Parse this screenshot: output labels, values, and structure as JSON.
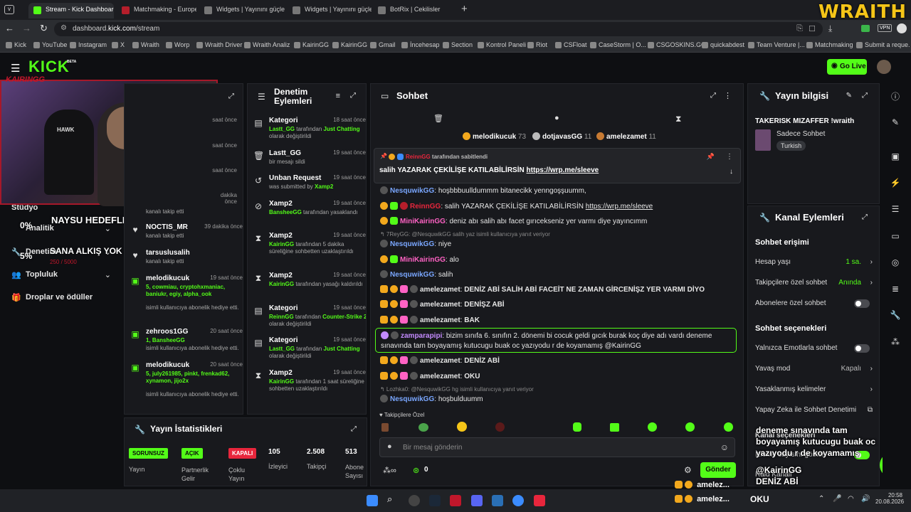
{
  "browser": {
    "tabs": [
      {
        "title": "Stream - Kick Dashboard",
        "active": true
      },
      {
        "title": "Matchmaking - Europe 5v5",
        "active": false
      },
      {
        "title": "Widgets | Yayınını güçlendi",
        "active": false
      },
      {
        "title": "Widgets | Yayınını güçlendi",
        "active": false
      },
      {
        "title": "BotRix | Cekilisler",
        "active": false
      }
    ],
    "new_tab": "+",
    "url_host": "dashboard.",
    "url_domain": "kick.com",
    "url_path": "/stream",
    "bookmarks": [
      "Kick",
      "YouTube",
      "Instagram",
      "X",
      "Wraith",
      "Worp",
      "Wraith Driver",
      "Wraith Analiz",
      "KairinGG",
      "KairinGG",
      "Gmail",
      "İncehesap",
      "Section",
      "Kontrol Paneli",
      "Riot",
      "CSFloat",
      "CaseStorm | O...",
      "CSGOSKINS.GG",
      "quickabdest",
      "Team Venture |...",
      "Matchmaking",
      "Submit a reque..."
    ],
    "vpn": "VPN"
  },
  "overlay": {
    "wraith_logo": "WRAITH",
    "streamer_tag": "KAIRINGG",
    "webcam_brand": "HAWK",
    "goal_1_text": "NAYSU HEDEFLER",
    "goal_1_pct": "0%",
    "goal_2_text": "SANA ALKIŞ YOK ANCA KICK",
    "goal_2_pct": "5%",
    "goal_2_progress": "250 / 5000",
    "popup_lines": [
      "deneme sınavında tam",
      "boyayamış kutucugu buak oc",
      "yazıyodu r de koyamamış",
      "@KairinGG"
    ],
    "popup_bottom": "DENİZ ABİ",
    "bottom_chat": [
      {
        "user": "amelez...",
        "text": "DENİZ ABİ"
      },
      {
        "user": "amelez...",
        "text": "OKU"
      }
    ]
  },
  "header": {
    "logo": "KICK",
    "beta": "BETA",
    "go_live": "Go Live"
  },
  "leftnav": {
    "items": [
      {
        "label": "Stüdyo",
        "chevron": false
      },
      {
        "label": "Analitik",
        "chevron": true
      },
      {
        "label": "Denetim",
        "chevron": true
      },
      {
        "label": "Topluluk",
        "chevron": true
      },
      {
        "label": "Droplar ve ödüller",
        "chevron": false
      }
    ]
  },
  "activity": {
    "items": [
      {
        "name": "",
        "time": "saat önce",
        "desc": ""
      },
      {
        "name": "",
        "time": "saat önce",
        "desc": ""
      },
      {
        "name": "",
        "time": "saat önce",
        "desc": ""
      },
      {
        "name": "",
        "time": "dakika önce",
        "desc": "kanalı takip etti"
      },
      {
        "name": "NOCTIS_MR",
        "time": "39 dakika önce",
        "desc": "kanalı takip etti"
      },
      {
        "name": "tarsuslusalih",
        "time": "",
        "desc": "kanalı takip etti"
      },
      {
        "name": "melodikucuk",
        "time": "19 saat önce",
        "gift": "5, cowmiau, cryptohxmaniac, baniukr, egiy, alpha_ook",
        "desc": "isimli kullanıcıya abonelik hediye etti."
      },
      {
        "name": "zehroos1GG",
        "time": "20 saat önce",
        "gift": "1, BansheeGG",
        "desc": "isimli kullanıcıya abonelik hediye etti."
      },
      {
        "name": "melodikucuk",
        "time": "20 saat önce",
        "gift": "5, july261985, pinkt, frenkad62, xynamon, jijo2x",
        "desc": "isimli kullanıcıya abonelik hediye etti."
      }
    ]
  },
  "moderation": {
    "title_line1": "Denetim",
    "title_line2": "Eylemleri",
    "items": [
      {
        "icon": "category",
        "title": "Kategori",
        "time": "18 saat önce",
        "desc_green": "Lastt_GG",
        "desc": " tarafından ",
        "desc_green2": "Just Chatting",
        "desc2": " olarak değiştirildi"
      },
      {
        "icon": "trash",
        "title": "Lastt_GG",
        "time": "19 saat önce",
        "desc_green": "",
        "desc": "bir mesajı sildi",
        "desc_green2": "",
        "desc2": ""
      },
      {
        "icon": "history",
        "title": "Unban Request",
        "time": "19 saat önce",
        "desc_green": "",
        "desc": "was submitted by ",
        "desc_green2": "Xamp2",
        "desc2": ""
      },
      {
        "icon": "ban",
        "title": "Xamp2",
        "time": "19 saat önce",
        "desc_green": "BansheeGG",
        "desc": " tarafından yasaklandı",
        "desc_green2": "",
        "desc2": ""
      },
      {
        "icon": "hourglass",
        "title": "Xamp2",
        "time": "19 saat önce",
        "desc_green": "KairinGG",
        "desc": " tarafından 5 dakika süreliğine sohbetten uzaklaştırıldı",
        "desc_green2": "",
        "desc2": ""
      },
      {
        "icon": "hourglass",
        "title": "Xamp2",
        "time": "19 saat önce",
        "desc_green": "KairinGG",
        "desc": " tarafından yasağı kaldırıldı",
        "desc_green2": "",
        "desc2": ""
      },
      {
        "icon": "category",
        "title": "Kategori",
        "time": "19 saat önce",
        "desc_green": "ReinnGG",
        "desc": " tarafından ",
        "desc_green2": "Counter-Strike 2",
        "desc2": " olarak değiştirildi"
      },
      {
        "icon": "category",
        "title": "Kategori",
        "time": "19 saat önce",
        "desc_green": "Lastt_GG",
        "desc": " tarafından ",
        "desc_green2": "Just Chatting",
        "desc2": " olarak değiştirildi"
      },
      {
        "icon": "hourglass",
        "title": "Xamp2",
        "time": "19 saat önce",
        "desc_green": "KairinGG",
        "desc": " tarafından 1 saat süreliğine sohbetten uzaklaştırıldı",
        "desc_green2": "",
        "desc2": ""
      }
    ]
  },
  "stats": {
    "title": "Yayın İstatistikleri",
    "items": [
      {
        "badge": "SORUNSUZ",
        "label": "Yayın",
        "color": "#53fc18"
      },
      {
        "badge": "AÇIK",
        "label": "Partnerlik Gelir",
        "color": "#53fc18"
      },
      {
        "badge": "KAPALI",
        "label": "Çoklu Yayın",
        "color": "#e8263c"
      },
      {
        "value": "105",
        "label": "İzleyici"
      },
      {
        "value": "2.508",
        "label": "Takipçi"
      },
      {
        "value": "513",
        "label": "Abone Sayısı"
      }
    ]
  },
  "chat": {
    "title": "Sohbet",
    "top_gifters": [
      {
        "name": "melodikucuk",
        "count": "73"
      },
      {
        "name": "dotjavasGG",
        "count": "11"
      },
      {
        "name": "amelezamet",
        "count": "11"
      }
    ],
    "pinned_by": "ReinnGG",
    "pinned_label": "tarafından sabitlendi",
    "pinned_text": "salih YAZARAK ÇEKİLİŞE KATILABİLİRSİN ",
    "pinned_link": "https://wrp.me/sleeve",
    "messages": [
      {
        "user": "NesquwikGG",
        "color": "#7aa7ff",
        "text": "hoşbbbuulldummm bitanecikk yenngoşşuumm,"
      },
      {
        "user": "ReinnGG",
        "color": "#e8263c",
        "text": "salih YAZARAK ÇEKİLİŞE KATILABİLİRSİN ",
        "link": "https://wrp.me/sleeve"
      },
      {
        "user": "MiniKairinGG",
        "color": "#ff62c4",
        "text": "deniz abı salih abı facet gırıcekseniz yer varmı diye yayıncımm"
      },
      {
        "reply": "↰ 7ReyGG: @NesquwikGG salih yaz isimli kullanıcıya yanıt veriyor"
      },
      {
        "user": "NesquwikGG",
        "color": "#7aa7ff",
        "text": "niye"
      },
      {
        "user": "MiniKairinGG",
        "color": "#ff62c4",
        "text": "alo"
      },
      {
        "user": "NesquwikGG",
        "color": "#7aa7ff",
        "text": "salih"
      },
      {
        "user": "amelezamet",
        "color": "#ffffff",
        "text": "DENİZ ABİ SALİH ABİ FACEİT NE ZAMAN GİRCENİŞZ YER VARMI DİYO"
      },
      {
        "user": "amelezamet",
        "color": "#ffffff",
        "text": "DENİŞZ ABİ"
      },
      {
        "user": "amelezamet",
        "color": "#ffffff",
        "text": "BAK"
      },
      {
        "highlight": true,
        "user": "zamparapipi",
        "color": "#c48bff",
        "text": "bizim sınıfa 6. sınıfın 2. dönemi bi cocuk geldi gıcık burak koç diye adı vardı deneme",
        "text2": "sınavında tam boyayamış kutucugu buak oc yazıyodu r de koyamamış @KairinGG"
      },
      {
        "user": "amelezamet",
        "color": "#ffffff",
        "text": "DENİZ ABİ"
      },
      {
        "user": "amelezamet",
        "color": "#ffffff",
        "text": "OKU"
      },
      {
        "reply": "↰ Lozhka0: @NesquwikGG hg isimli kullanıcıya yanıt veriyor"
      },
      {
        "user": "NesquwikGG",
        "color": "#7aa7ff",
        "text": "hoşbulduumm"
      }
    ],
    "followers_only": "Takipçilere Özel",
    "input_placeholder": "Bir mesaj gönderin",
    "points": "0",
    "send": "Gönder"
  },
  "streaminfo": {
    "title": "Yayın bilgisi",
    "stream_title": "TAKERISK MIZAFFER !wraith",
    "category": "Sadece Sohbet",
    "language": "Turkish"
  },
  "channel": {
    "title": "Kanal Eylemleri",
    "chat_access": "Sohbet erişimi",
    "rows": [
      {
        "label": "Hesap yaşı",
        "value": "1 sa.",
        "value_color": "#53fc18",
        "kind": "chevron"
      },
      {
        "label": "Takipçilere özel sohbet",
        "value": "Anında",
        "value_color": "#53fc18",
        "kind": "chevron"
      },
      {
        "label": "Abonelere özel sohbet",
        "value": "",
        "kind": "toggle"
      }
    ],
    "chat_options": "Sohbet seçenekleri",
    "rows2": [
      {
        "label": "Yalnızca Emotlarla sohbet",
        "value": "",
        "kind": "toggle"
      },
      {
        "label": "Yavaş mod",
        "value": "Kapalı",
        "value_color": "#bbbbbb",
        "kind": "chevron"
      },
      {
        "label": "Yasaklanmış kelimeler",
        "value": "",
        "kind": "chevron"
      },
      {
        "label": "Yapay Zeka ile Sohbet Denetimi",
        "value": "",
        "kind": "external"
      }
    ],
    "more_1": "Kanal seçenekleri",
    "more_2": "İzleme sayısını göster",
    "more_3": "Raid Kanalı"
  },
  "taskbar": {
    "time": "20:58",
    "date": "20.08.2026"
  },
  "colors": {
    "kick_green": "#53fc18",
    "panel": "#18191d",
    "bg": "#0e0f12"
  }
}
